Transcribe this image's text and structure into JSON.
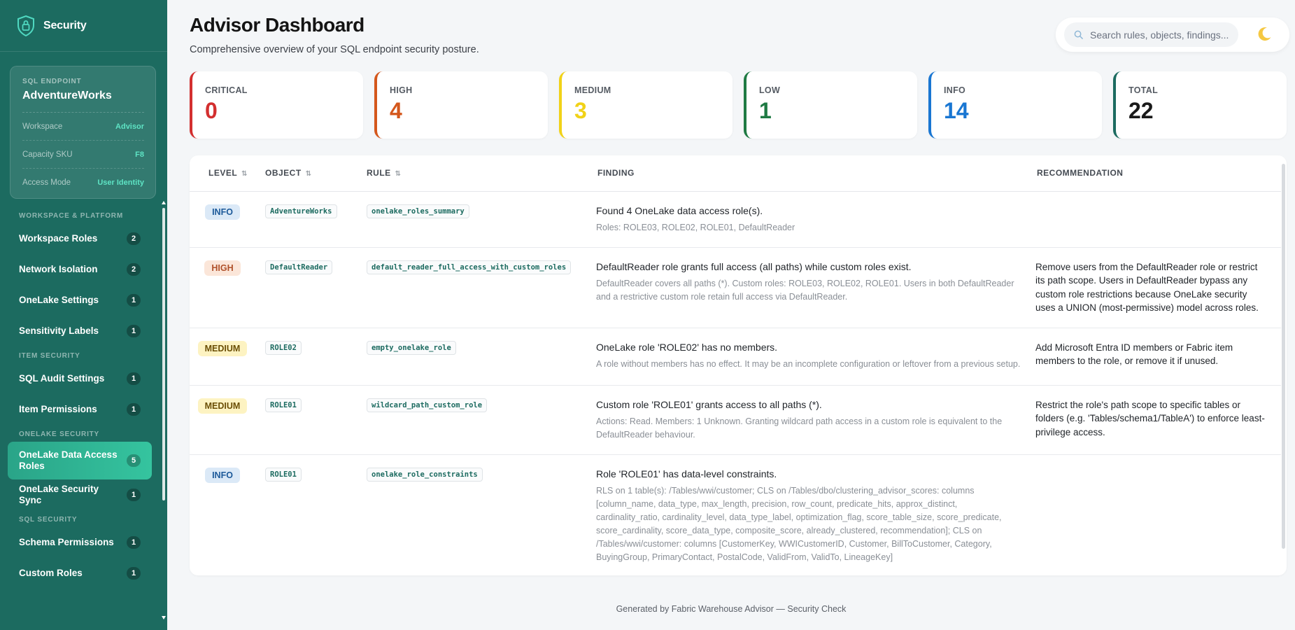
{
  "brand": {
    "title": "Security"
  },
  "endpoint": {
    "label": "SQL ENDPOINT",
    "name": "AdventureWorks",
    "rows": [
      {
        "key": "Workspace",
        "value": "Advisor"
      },
      {
        "key": "Capacity SKU",
        "value": "F8"
      },
      {
        "key": "Access Mode",
        "value": "User Identity"
      }
    ]
  },
  "nav": {
    "sections": [
      {
        "title": "WORKSPACE & PLATFORM",
        "items": [
          {
            "label": "Workspace Roles",
            "count": "2"
          },
          {
            "label": "Network Isolation",
            "count": "2"
          },
          {
            "label": "OneLake Settings",
            "count": "1"
          },
          {
            "label": "Sensitivity Labels",
            "count": "1"
          }
        ]
      },
      {
        "title": "ITEM SECURITY",
        "items": [
          {
            "label": "SQL Audit Settings",
            "count": "1"
          },
          {
            "label": "Item Permissions",
            "count": "1"
          }
        ]
      },
      {
        "title": "ONELAKE SECURITY",
        "items": [
          {
            "label": "OneLake Data Access Roles",
            "count": "5",
            "active": true
          },
          {
            "label": "OneLake Security Sync",
            "count": "1"
          }
        ]
      },
      {
        "title": "SQL SECURITY",
        "items": [
          {
            "label": "Schema Permissions",
            "count": "1"
          },
          {
            "label": "Custom Roles",
            "count": "1"
          }
        ]
      }
    ]
  },
  "header": {
    "title": "Advisor Dashboard",
    "subtitle": "Comprehensive overview of your SQL endpoint security posture."
  },
  "search": {
    "placeholder": "Search rules, objects, findings..."
  },
  "summary": [
    {
      "key": "CRITICAL",
      "value": "0",
      "color": "#d32f2f"
    },
    {
      "key": "HIGH",
      "value": "4",
      "color": "#d4571c"
    },
    {
      "key": "MEDIUM",
      "value": "3",
      "color": "#f1d217"
    },
    {
      "key": "LOW",
      "value": "1",
      "color": "#1f7a43"
    },
    {
      "key": "INFO",
      "value": "14",
      "color": "#1976d2"
    },
    {
      "key": "TOTAL",
      "value": "22",
      "color": "#1c6b60",
      "valueColor": "#1a1a1a"
    }
  ],
  "table": {
    "columns": [
      "LEVEL",
      "OBJECT",
      "RULE",
      "FINDING",
      "RECOMMENDATION"
    ],
    "sort_icon": "⇅",
    "rows": [
      {
        "level": "INFO",
        "object": "AdventureWorks",
        "rule": "onelake_roles_summary",
        "finding": "Found 4 OneLake data access role(s).",
        "detail": "Roles: ROLE03, ROLE02, ROLE01, DefaultReader",
        "recommendation": ""
      },
      {
        "level": "HIGH",
        "object": "DefaultReader",
        "rule": "default_reader_full_access_with_custom_roles",
        "finding": "DefaultReader role grants full access (all paths) while custom roles exist.",
        "detail": "DefaultReader covers all paths (*). Custom roles: ROLE03, ROLE02, ROLE01. Users in both DefaultReader and a restrictive custom role retain full access via DefaultReader.",
        "recommendation": "Remove users from the DefaultReader role or restrict its path scope. Users in DefaultReader bypass any custom role restrictions because OneLake security uses a UNION (most-permissive) model across roles."
      },
      {
        "level": "MEDIUM",
        "object": "ROLE02",
        "rule": "empty_onelake_role",
        "finding": "OneLake role 'ROLE02' has no members.",
        "detail": "A role without members has no effect. It may be an incomplete configuration or leftover from a previous setup.",
        "recommendation": "Add Microsoft Entra ID members or Fabric item members to the role, or remove it if unused."
      },
      {
        "level": "MEDIUM",
        "object": "ROLE01",
        "rule": "wildcard_path_custom_role",
        "finding": "Custom role 'ROLE01' grants access to all paths (*).",
        "detail": "Actions: Read. Members: 1 Unknown. Granting wildcard path access in a custom role is equivalent to the DefaultReader behaviour.",
        "recommendation": "Restrict the role's path scope to specific tables or folders (e.g. 'Tables/schema1/TableA') to enforce least-privilege access."
      },
      {
        "level": "INFO",
        "object": "ROLE01",
        "rule": "onelake_role_constraints",
        "finding": "Role 'ROLE01' has data-level constraints.",
        "detail": "RLS on 1 table(s): /Tables/wwi/customer; CLS on /Tables/dbo/clustering_advisor_scores: columns [column_name, data_type, max_length, precision, row_count, predicate_hits, approx_distinct, cardinality_ratio, cardinality_level, data_type_label, optimization_flag, score_table_size, score_predicate, score_cardinality, score_data_type, composite_score, already_clustered, recommendation]; CLS on /Tables/wwi/customer: columns [CustomerKey, WWICustomerID, Customer, BillToCustomer, Category, BuyingGroup, PrimaryContact, PostalCode, ValidFrom, ValidTo, LineageKey]",
        "recommendation": ""
      }
    ]
  },
  "footer": {
    "text": "Generated by Fabric Warehouse Advisor — Security Check"
  }
}
